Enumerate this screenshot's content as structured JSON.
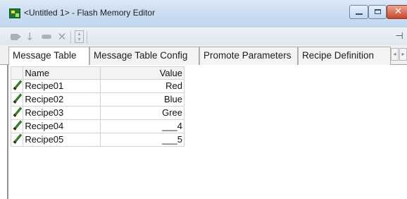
{
  "window": {
    "title": "<Untitled 1> - Flash Memory Editor",
    "icon": "flash-memory-app-icon",
    "controls": [
      "minimize",
      "maximize",
      "close"
    ]
  },
  "toolbar": {
    "buttons": [
      {
        "icon": "tag-icon",
        "enabled": false
      },
      {
        "icon": "download-arrow-icon",
        "enabled": false
      },
      {
        "icon": "eraser-icon",
        "enabled": false
      },
      {
        "icon": "delete-x-icon",
        "enabled": false
      },
      {
        "icon": "spinner-icon",
        "enabled": false
      }
    ],
    "pin_icon": "pin-icon"
  },
  "tabs": [
    {
      "label": "Message Table",
      "active": true
    },
    {
      "label": "Message Table Config",
      "active": false
    },
    {
      "label": "Promote Parameters",
      "active": false
    },
    {
      "label": "Recipe Definition",
      "active": false
    }
  ],
  "grid": {
    "columns": [
      "Name",
      "Value"
    ],
    "rows": [
      {
        "icon": "pencil-icon",
        "name": "Recipe01",
        "value": "Red"
      },
      {
        "icon": "pencil-icon",
        "name": "Recipe02",
        "value": "Blue"
      },
      {
        "icon": "pencil-icon",
        "name": "Recipe03",
        "value": "Gree"
      },
      {
        "icon": "pencil-icon",
        "name": "Recipe04",
        "value": "___4"
      },
      {
        "icon": "pencil-icon",
        "name": "Recipe05",
        "value": "___5"
      }
    ]
  },
  "colors": {
    "titlebar": "#c9dcf1",
    "close_button": "#c8452d",
    "pencil": "#4aa12f"
  }
}
